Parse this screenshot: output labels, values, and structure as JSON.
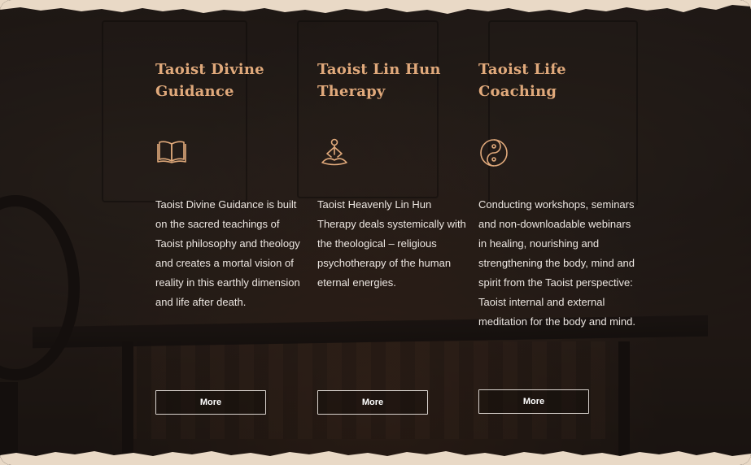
{
  "colors": {
    "accent": "#e0a97b",
    "text": "#ece6e1",
    "button_border": "#d8d2cd",
    "paper_edge": "#e9d9c6"
  },
  "services": [
    {
      "title": "Taoist Divine Guidance",
      "icon": "book-icon",
      "description": "Taoist Divine Guidance is built on the sacred teachings of Taoist philosophy and theology and creates a mortal vision of reality in this earthly dimension and life after death.",
      "button_label": "More"
    },
    {
      "title": "Taoist Lin Hun Therapy",
      "icon": "meditation-icon",
      "description": "Taoist Heavenly Lin Hun Therapy deals systemically with the theological – religious psychotherapy of the human eternal energies.",
      "button_label": "More"
    },
    {
      "title": "Taoist Life Coaching",
      "icon": "yin-yang-icon",
      "description": "Conducting workshops, seminars and non-downloadable webinars in healing, nourishing and strengthening the body, mind and spirit from the Taoist perspective: Taoist internal and external meditation for the body and mind.",
      "button_label": "More"
    }
  ]
}
